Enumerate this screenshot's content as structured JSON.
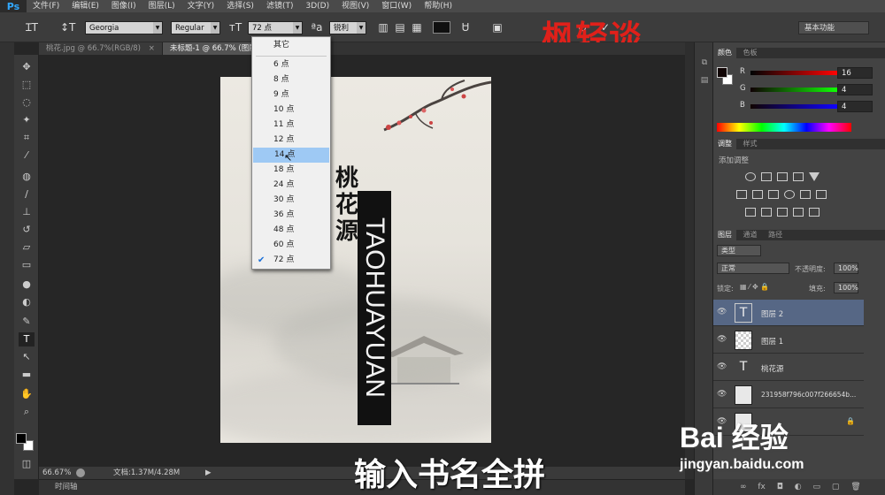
{
  "app": {
    "logo": "Ps"
  },
  "menu": [
    "文件(F)",
    "编辑(E)",
    "图像(I)",
    "图层(L)",
    "文字(Y)",
    "选择(S)",
    "滤镜(T)",
    "3D(D)",
    "视图(V)",
    "窗口(W)",
    "帮助(H)"
  ],
  "options": {
    "font_family": "Georgia",
    "font_style": "Regular",
    "font_size": "72 点",
    "antialias": "锐利",
    "workspace": "基本功能",
    "text_color": "#101010"
  },
  "watermark_title": "枫轻谈",
  "tabs": [
    {
      "label": "桃花.jpg @ 66.7%(RGB/8)",
      "close": "×"
    },
    {
      "label": "未标题-1 @ 66.7% (图层",
      "close": ""
    }
  ],
  "size_dropdown": {
    "other": "其它",
    "items": [
      "6 点",
      "8 点",
      "9 点",
      "10 点",
      "11 点",
      "12 点",
      "14 点",
      "18 点",
      "24 点",
      "30 点",
      "36 点",
      "48 点",
      "60 点",
      "72 点"
    ],
    "highlighted": "14 点",
    "checked": "72 点"
  },
  "artwork": {
    "title_cn": "桃花源",
    "title_en": "TAOHUAYUAN"
  },
  "status": {
    "zoom": "66.67%",
    "doc_size": "文档:1.37M/4.28M",
    "timeline": "时间轴"
  },
  "color_panel": {
    "tabs": [
      "颜色",
      "色板"
    ],
    "r_label": "R",
    "r_value": "16",
    "g_label": "G",
    "g_value": "4",
    "b_label": "B",
    "b_value": "4"
  },
  "adjust_panel": {
    "tabs": [
      "调整",
      "样式"
    ],
    "label": "添加调整"
  },
  "layers_panel": {
    "tabs": [
      "图层",
      "通道",
      "路径"
    ],
    "kind": "类型",
    "blend_mode": "正常",
    "opacity_label": "不透明度:",
    "opacity_value": "100%",
    "lock_label": "锁定:",
    "fill_label": "填充:",
    "fill_value": "100%",
    "layers": [
      {
        "name": "图层 2",
        "thumb": "T",
        "active": true
      },
      {
        "name": "图层 1",
        "thumb": "",
        "active": false
      },
      {
        "name": "桃花源",
        "thumb": "T",
        "active": false
      },
      {
        "name": "231958f796c007f266654b...",
        "thumb": "",
        "active": false
      }
    ]
  },
  "overlay": {
    "subtitle": "输入书名全拼",
    "baidu_logo": "Bai 经验",
    "baidu_url": "jingyan.baidu.com"
  }
}
